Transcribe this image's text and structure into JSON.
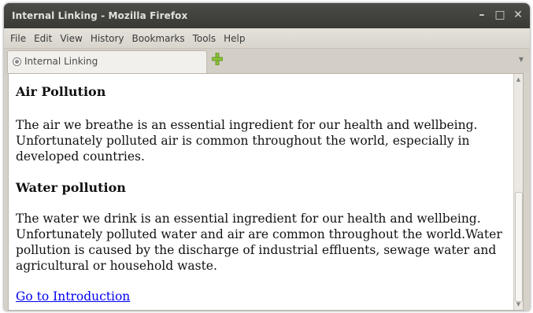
{
  "window": {
    "title": "Internal Linking - Mozilla Firefox",
    "controls": {
      "minimize": "–",
      "maximize": "□",
      "close": "✕"
    }
  },
  "menubar": {
    "items": [
      "File",
      "Edit",
      "View",
      "History",
      "Bookmarks",
      "Tools",
      "Help"
    ]
  },
  "tabs": {
    "active_tab": {
      "label": "Internal Linking",
      "icon": "page-icon"
    },
    "new_tab_icon": "puzzle-plus-icon",
    "tab_list_icon": "▼"
  },
  "page": {
    "sections": [
      {
        "heading": "Air Pollution",
        "text": "The air we breathe is an essential ingredient for our health and wellbeing. Unfortunately polluted air is common throughout the world, especially in developed countries."
      },
      {
        "heading": "Water pollution",
        "text": "The water we drink is an essential ingredient for our health and wellbeing. Unfortunately polluted water and air are common throughout the world.Water pollution is caused by the discharge of industrial effluents, sewage water and agricultural or household waste."
      }
    ],
    "link": {
      "label": "Go to Introduction"
    }
  },
  "colors": {
    "titlebar": "#3f3f3c",
    "menubar": "#dedad3",
    "link": "#0000ee"
  }
}
